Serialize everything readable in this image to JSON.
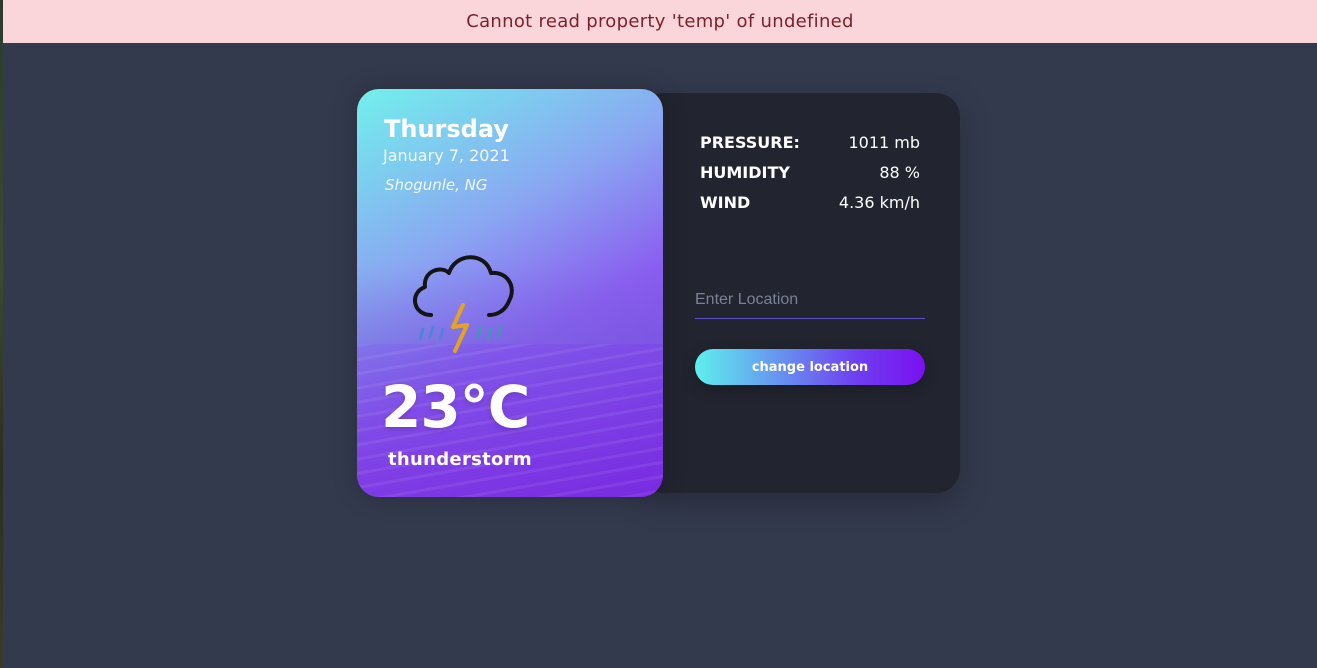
{
  "error": {
    "message": "Cannot read property 'temp' of undefined"
  },
  "weather_card": {
    "day": "Thursday",
    "date": "January 7, 2021",
    "location": "Shogunle, NG",
    "icon": "thunderstorm-icon",
    "temperature": "23°C",
    "description": "thunderstorm"
  },
  "details": {
    "rows": [
      {
        "label": "PRESSURE:",
        "value": "1011 mb"
      },
      {
        "label": "HUMIDITY",
        "value": "88 %"
      },
      {
        "label": "WIND",
        "value": "4.36 km/h"
      }
    ]
  },
  "location_form": {
    "placeholder": "Enter Location",
    "value": "",
    "button_label": "change location"
  },
  "colors": {
    "background": "#343a4e",
    "panel": "#222530",
    "error_bg": "#fad6db",
    "error_text": "#7b1f2b",
    "gradient_start": "#5ef0ee",
    "gradient_end": "#7a10f0"
  }
}
